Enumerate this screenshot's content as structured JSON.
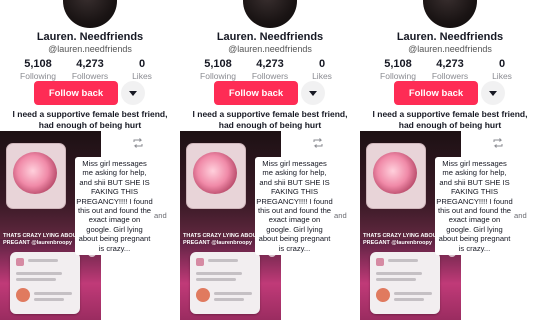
{
  "profile": {
    "name": "Lauren. Needfriends",
    "handle": "@lauren.needfriends",
    "stats": [
      {
        "value": "5,108",
        "label": "Following"
      },
      {
        "value": "4,273",
        "label": "Followers"
      },
      {
        "value": "0",
        "label": "Likes"
      }
    ],
    "follow_label": "Follow back",
    "bio": "I need a supportive female best friend, had enough of being hurt"
  },
  "post": {
    "caption_overlay": "THATS CRAZY LYING ABOUT BEING PREGANT @laurenbroopy",
    "note_text": "Miss girl messages me asking for help, and shii BUT SHE IS FAKING THIS PREGANCY!!!! I found this out and found the exact image on google. Girl lying about being pregnant is crazy...",
    "trailing_text": "and"
  },
  "icons": {
    "more": "chevron-down-icon",
    "repost": "repost-icon",
    "avatar": "avatar"
  },
  "colors": {
    "accent": "#fe2c55",
    "text": "#161823",
    "muted": "#8a8b91"
  }
}
